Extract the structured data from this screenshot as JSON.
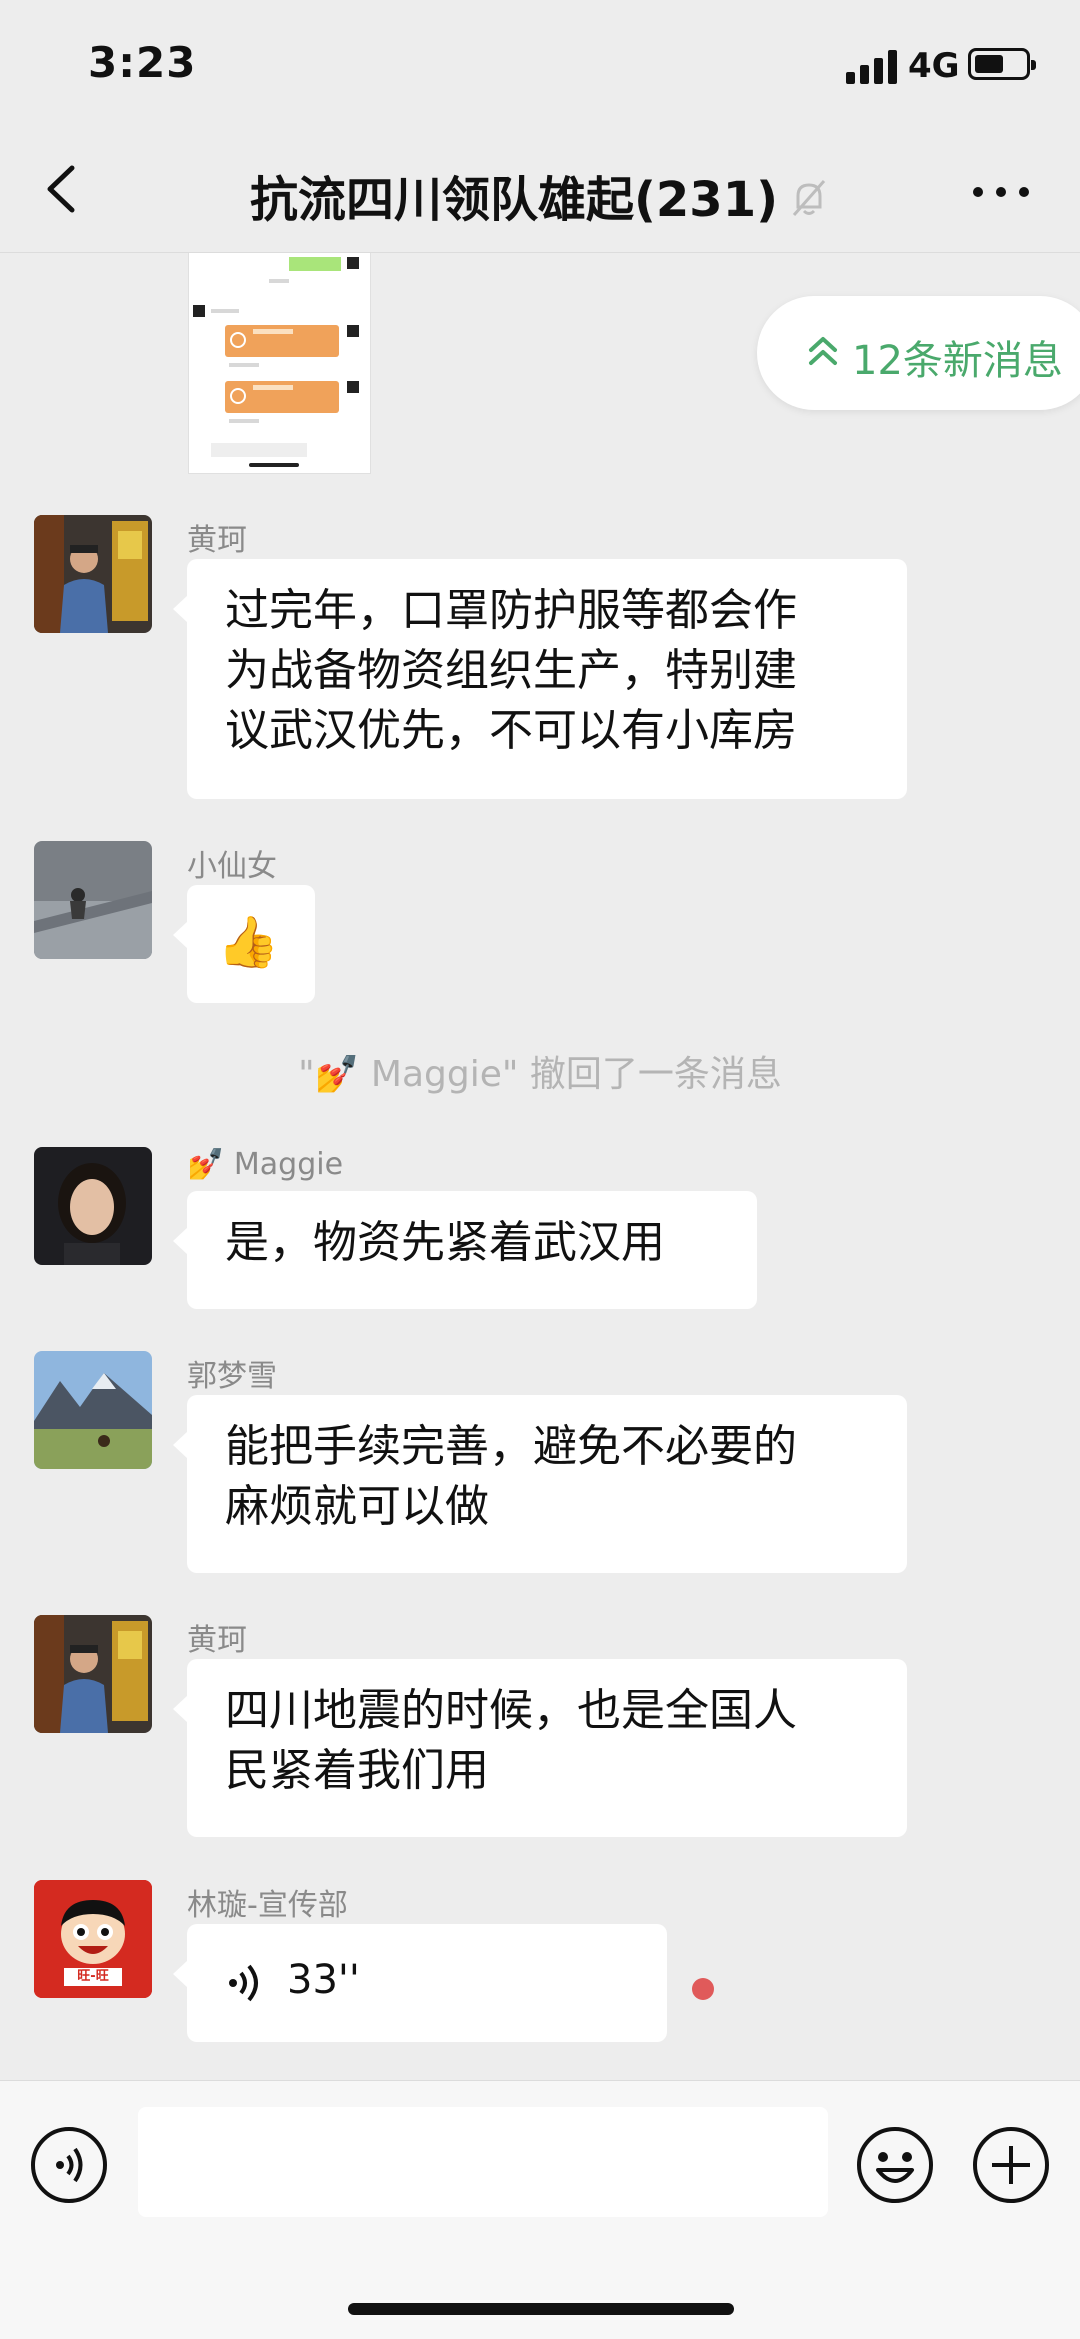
{
  "status_bar": {
    "time": "3:23",
    "network": "4G"
  },
  "header": {
    "title": "抗流四川领队雄起(231)",
    "back_icon": "chevron-left-icon",
    "more_icon": "more-horizontal-icon",
    "mute_icon": "bell-off-icon"
  },
  "new_messages": {
    "label": "12条新消息",
    "icon": "double-chevron-up-icon"
  },
  "messages": [
    {
      "sender": "黄珂",
      "lines": [
        "过完年，口罩防护服等都会作",
        "为战备物资组织生产，特别建",
        "议武汉优先，不可以有小库房"
      ]
    },
    {
      "sender": "小仙女",
      "emoji": "👍"
    },
    {
      "sender": "💅 Maggie",
      "lines": [
        "是，物资先紧着武汉用"
      ]
    },
    {
      "sender": "郭梦雪",
      "lines": [
        "能把手续完善，避免不必要的",
        "麻烦就可以做"
      ]
    },
    {
      "sender": "黄珂",
      "lines": [
        "四川地震的时候，也是全国人",
        "民紧着我们用"
      ]
    },
    {
      "sender": "林璇-宣传部",
      "voice_duration": "33''",
      "avatar_text": "旺-旺"
    }
  ],
  "system_message": "\"💅 Maggie\" 撤回了一条消息",
  "colors": {
    "background": "#ededed",
    "bubble": "#ffffff",
    "accent_green": "#4aa96c",
    "unread_dot": "#e05a5a"
  },
  "input_bar": {
    "voice_icon": "voice-icon",
    "emoji_icon": "emoji-icon",
    "add_icon": "plus-circle-icon"
  }
}
